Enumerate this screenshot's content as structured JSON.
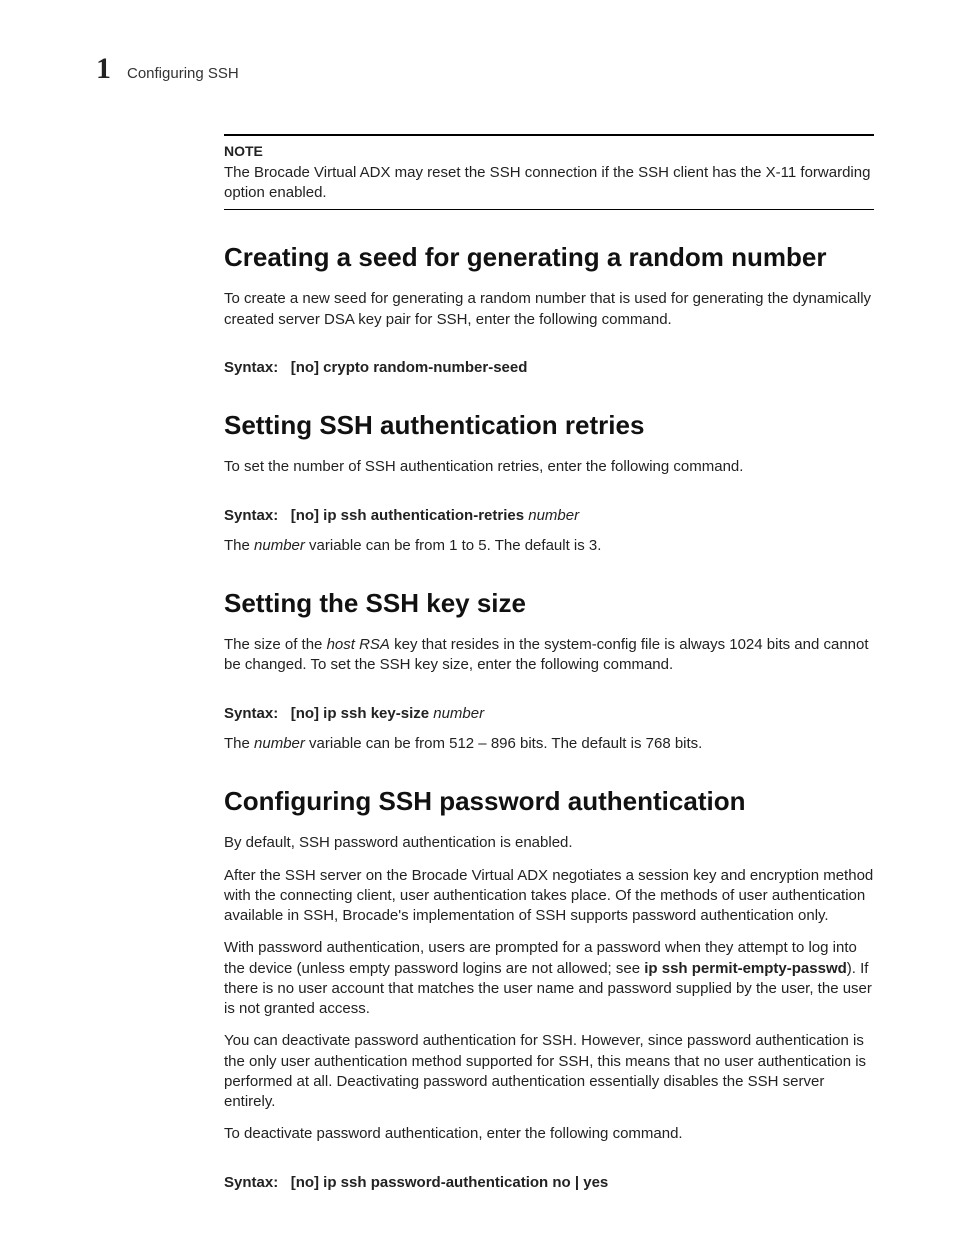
{
  "header": {
    "chapter_number": "1",
    "chapter_title": "Configuring SSH"
  },
  "note": {
    "label": "NOTE",
    "body": "The Brocade Virtual ADX may reset the SSH connection if the SSH client has the X-11 forwarding option enabled."
  },
  "sec_seed": {
    "heading": "Creating a seed for generating a random number",
    "para1": "To create a new seed for generating a random number that is used for generating the dynamically created server DSA key pair for SSH, enter the following command.",
    "syntax_label": "Syntax:",
    "syntax_cmd": "[no] crypto random-number-seed"
  },
  "sec_retries": {
    "heading": "Setting SSH authentication retries",
    "para1": "To set the number of SSH authentication retries, enter the following command.",
    "syntax_label": "Syntax:",
    "syntax_cmd": "[no] ip ssh authentication-retries ",
    "syntax_var": "number",
    "para2_a": "The ",
    "para2_var": "number",
    "para2_b": " variable can be from 1 to 5. The default is 3."
  },
  "sec_keysize": {
    "heading": "Setting the SSH key size",
    "para1_a": "The size of the ",
    "para1_var": "host RSA",
    "para1_b": " key that resides in the system-config file is always 1024 bits and cannot be changed. To set the SSH key size, enter the following command.",
    "syntax_label": "Syntax:",
    "syntax_cmd": "[no] ip ssh key-size ",
    "syntax_var": "number",
    "para2_a": "The ",
    "para2_var": "number",
    "para2_b": " variable can be from 512 – 896 bits. The default is 768 bits."
  },
  "sec_pwauth": {
    "heading": "Configuring SSH password authentication",
    "para1": "By default, SSH password authentication is enabled.",
    "para2": "After the SSH server on the Brocade Virtual ADX negotiates a session key and encryption method with the connecting client, user authentication takes place. Of the methods of user authentication available in SSH, Brocade's implementation of SSH supports password authentication only.",
    "para3_a": "With password authentication, users are prompted for a password when they attempt to log into the device (unless empty password logins are not allowed; see ",
    "para3_strong": "ip ssh permit-empty-passwd",
    "para3_b": "). If there is no user account that matches the user name and password supplied by the user, the user is not granted access.",
    "para4": "You can deactivate password authentication for SSH. However, since password authentication is the only user authentication method supported for SSH, this means that no user authentication is performed at all. Deactivating password authentication essentially disables the SSH server entirely.",
    "para5": "To deactivate password authentication, enter the following command.",
    "syntax_label": "Syntax:",
    "syntax_cmd": " [no] ip ssh password-authentication no | yes"
  }
}
